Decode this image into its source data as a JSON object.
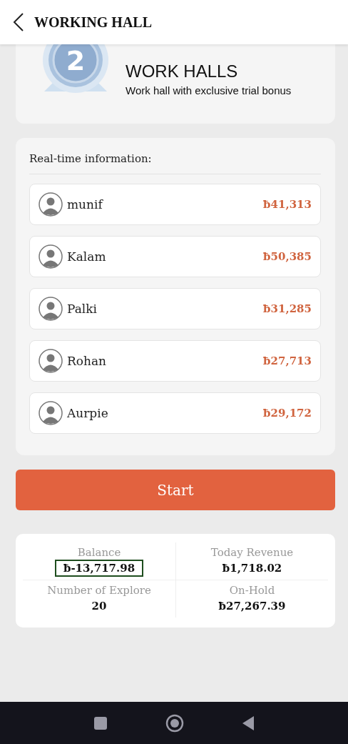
{
  "header": {
    "title": "WORKING HALL"
  },
  "hall": {
    "badge": "2",
    "title": "WORK HALLS",
    "subtitle": "Work hall with exclusive trial bonus"
  },
  "realtime": {
    "heading": "Real-time information:",
    "entries": [
      {
        "name": "munif",
        "amount": "ƀ41,313"
      },
      {
        "name": "Kalam",
        "amount": "ƀ50,385"
      },
      {
        "name": "Palki",
        "amount": "ƀ31,285"
      },
      {
        "name": "Rohan",
        "amount": "ƀ27,713"
      },
      {
        "name": "Aurpie",
        "amount": "ƀ29,172"
      }
    ]
  },
  "start_button": "Start",
  "stats": [
    {
      "label": "Balance",
      "value": "ƀ-13,717.98",
      "highlighted": true
    },
    {
      "label": "Today Revenue",
      "value": "ƀ1,718.02",
      "highlighted": false
    },
    {
      "label": "Number of Explore",
      "value": "20",
      "highlighted": false
    },
    {
      "label": "On-Hold",
      "value": "ƀ27,267.39",
      "highlighted": false
    }
  ]
}
